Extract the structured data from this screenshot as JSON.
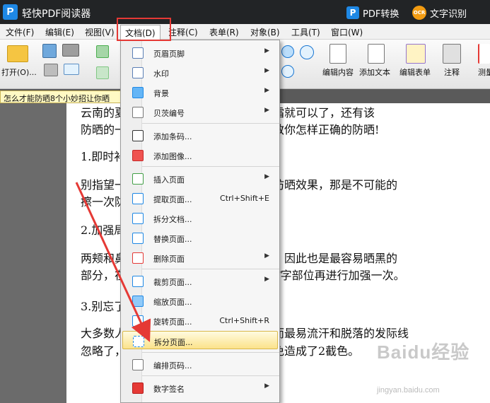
{
  "app": {
    "title": "轻快PDF阅读器",
    "logo_letter": "P",
    "pdf_convert": "PDF转换",
    "ocr_badge": "OCR",
    "ocr_label": "文字识别"
  },
  "menubar": {
    "file": "文件(F)",
    "edit": "编辑(E)",
    "view": "视图(V)",
    "document": "文档(D)",
    "comment": "注释(C)",
    "form": "表单(R)",
    "object": "对象(B)",
    "tools": "工具(T)",
    "window": "窗口(W)"
  },
  "toolbar": {
    "open": "打开(O)...",
    "edit_content": "编辑内容",
    "add_text": "添加文本",
    "edit_form": "编辑表单",
    "annotation": "注释",
    "measure": "测量"
  },
  "tab": {
    "title": "怎么才能防晒8个小妙招让你晒"
  },
  "document": {
    "lines": [
      "云南的夏季晒黑了，在脸上涂一层防晒霜就可以了，还有该",
      "防晒的一些小窍门，八个防晒小窍门，教你怎样正确的防晒!",
      "1.即时补防晒",
      "别指望一次涂抹防晒霜就能保持一天的防晒效果，那是不可能的",
      "擦一次防晒，才能保证完全防晒的效果。",
      "2.加强局部防晒",
      "两颊和鼻子由于在整个脸部中显得最高，因此也是最容易晒黑的",
      "部分，在涂完防晒霜后，最好在两颊和T字部位再进行加强一次。",
      "3.别忘了发际线",
      "大多数人在涂防晒时只注意擦脸部，然而最易流汗和脱落的发际线",
      "忽略了，发际线的地方可别被遗忘，避免造成了2截色。"
    ]
  },
  "dropdown": {
    "items": [
      {
        "label": "页眉页脚",
        "shortcut": "",
        "submenu": true
      },
      {
        "label": "水印",
        "shortcut": "",
        "submenu": true
      },
      {
        "label": "背景",
        "shortcut": "",
        "submenu": true
      },
      {
        "label": "贝茨编号",
        "shortcut": "",
        "submenu": true
      },
      {
        "label": "添加条码...",
        "shortcut": "",
        "submenu": false
      },
      {
        "label": "添加图像...",
        "shortcut": "",
        "submenu": false
      },
      {
        "label": "插入页面",
        "shortcut": "",
        "submenu": true
      },
      {
        "label": "提取页面...",
        "shortcut": "Ctrl+Shift+E",
        "submenu": false
      },
      {
        "label": "拆分文档...",
        "shortcut": "",
        "submenu": false
      },
      {
        "label": "替换页面...",
        "shortcut": "",
        "submenu": false
      },
      {
        "label": "删除页面",
        "shortcut": "",
        "submenu": true
      },
      {
        "label": "裁剪页面...",
        "shortcut": "",
        "submenu": true
      },
      {
        "label": "缩放页面...",
        "shortcut": "",
        "submenu": false
      },
      {
        "label": "旋转页面...",
        "shortcut": "Ctrl+Shift+R",
        "submenu": false
      },
      {
        "label": "拆分页面...",
        "shortcut": "",
        "submenu": false
      },
      {
        "label": "编排页码...",
        "shortcut": "",
        "submenu": false
      },
      {
        "label": "数字签名",
        "shortcut": "",
        "submenu": true
      }
    ],
    "active_item": "拆分页面..."
  },
  "watermark": {
    "logo": "Baidu经验",
    "url": "jingyan.baidu.com"
  },
  "colors": {
    "titlebar": "#222426",
    "highlight": "#e53935",
    "active_item": "#fbe28a",
    "arrow": "#e53935"
  }
}
